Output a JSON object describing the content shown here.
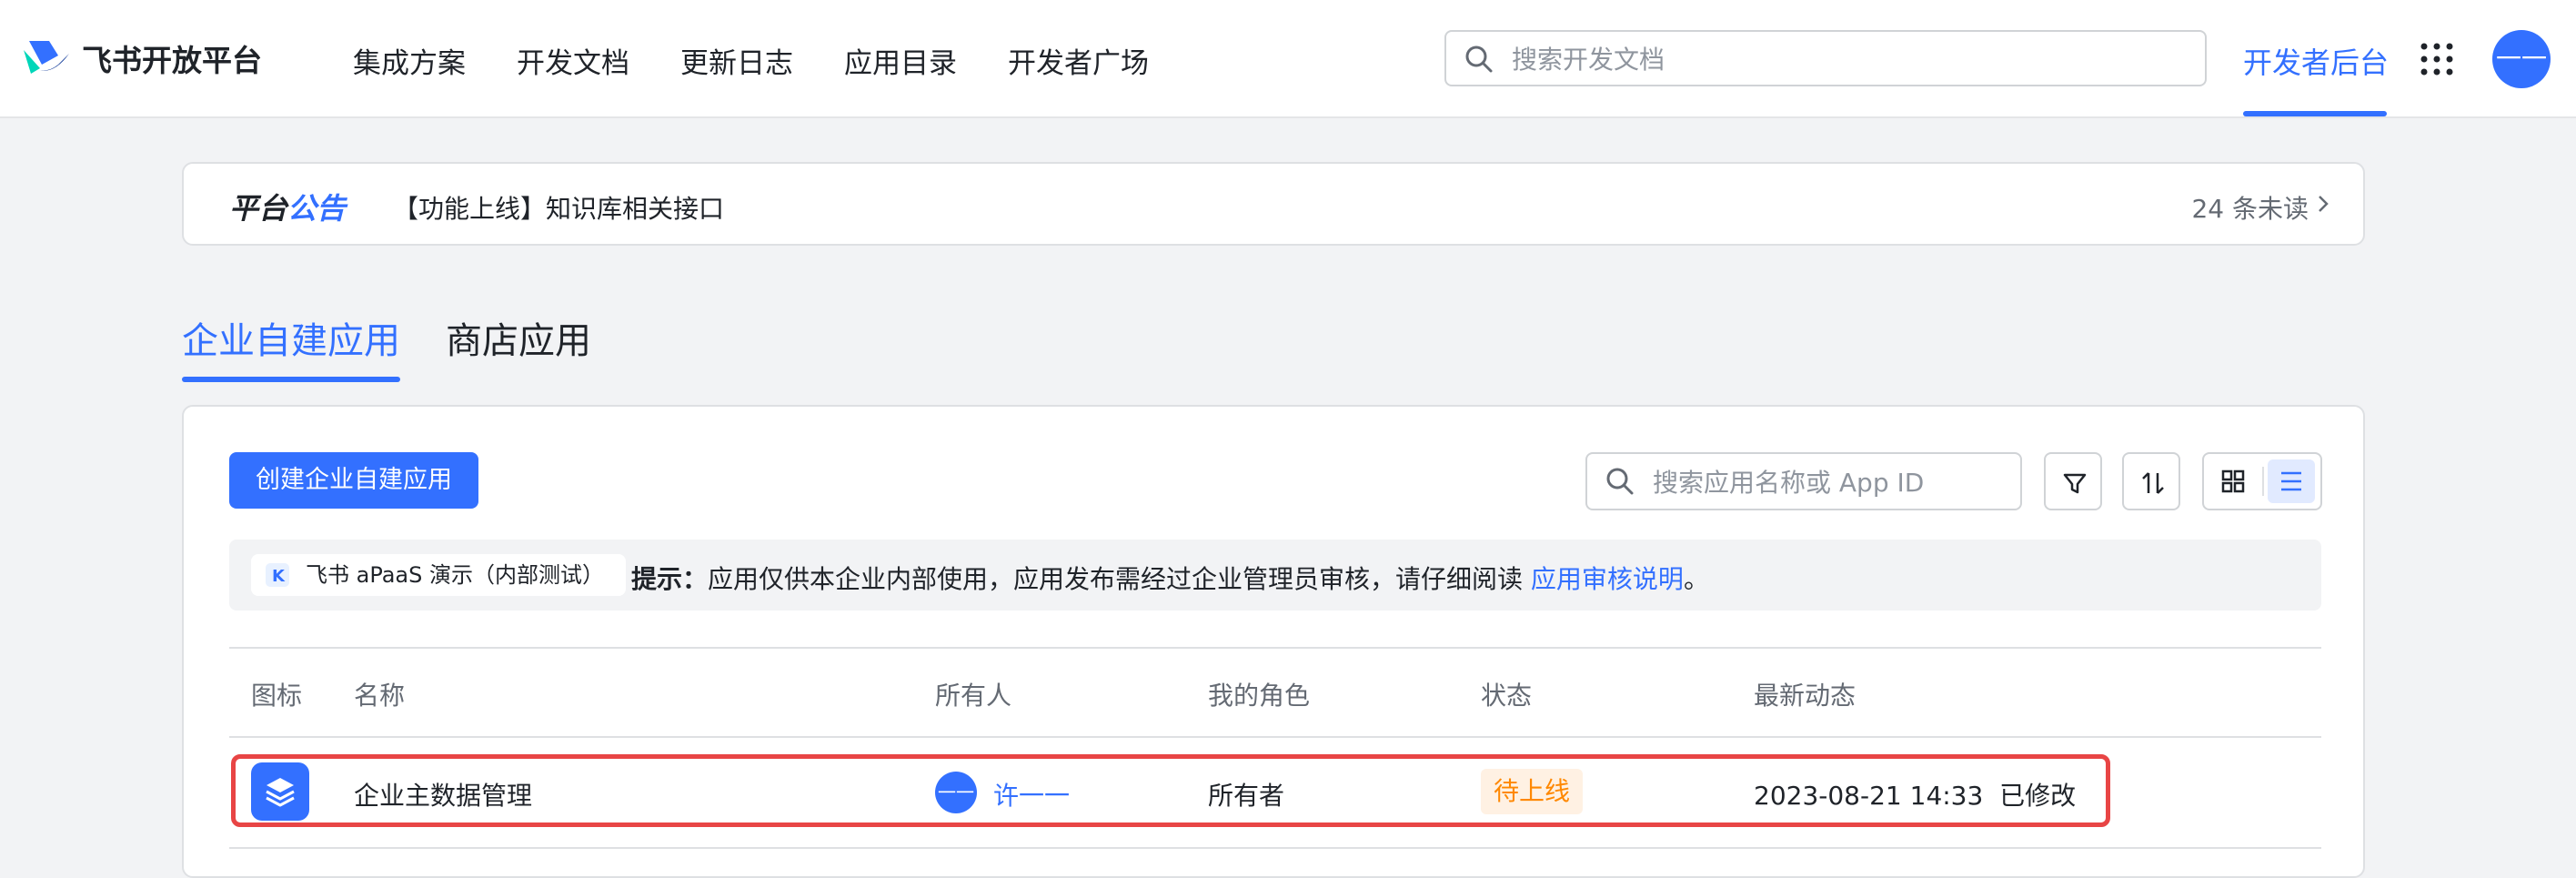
{
  "header": {
    "logo_text": "飞书开放平台",
    "nav": [
      "集成方案",
      "开发文档",
      "更新日志",
      "应用目录",
      "开发者广场"
    ],
    "search_placeholder": "搜索开发文档",
    "dev_console": "开发者后台",
    "avatar_text": "一一"
  },
  "notice": {
    "title_part1": "平台",
    "title_part2": "公告",
    "text": "【功能上线】知识库相关接口",
    "unread": "24 条未读"
  },
  "tabs": [
    "企业自建应用",
    "商店应用"
  ],
  "toolbar": {
    "create_label": "创建企业自建应用",
    "search_placeholder": "搜索应用名称或 App ID"
  },
  "hint": {
    "tenant": "飞书 aPaaS 演示（内部测试）",
    "label": "提示：",
    "text": "应用仅供本企业内部使用，应用发布需经过企业管理员审核，请仔细阅读 ",
    "link": "应用审核说明",
    "end": "。"
  },
  "table": {
    "headers": [
      "图标",
      "名称",
      "所有人",
      "我的角色",
      "状态",
      "最新动态"
    ],
    "rows": [
      {
        "name": "企业主数据管理",
        "owner_avatar": "一一",
        "owner": "许一一",
        "role": "所有者",
        "status": "待上线",
        "activity": "2023-08-21 14:33  已修改"
      }
    ]
  },
  "colors": {
    "accent": "#3370ff",
    "highlight": "#e84545",
    "status_warning": "#ff8800"
  }
}
